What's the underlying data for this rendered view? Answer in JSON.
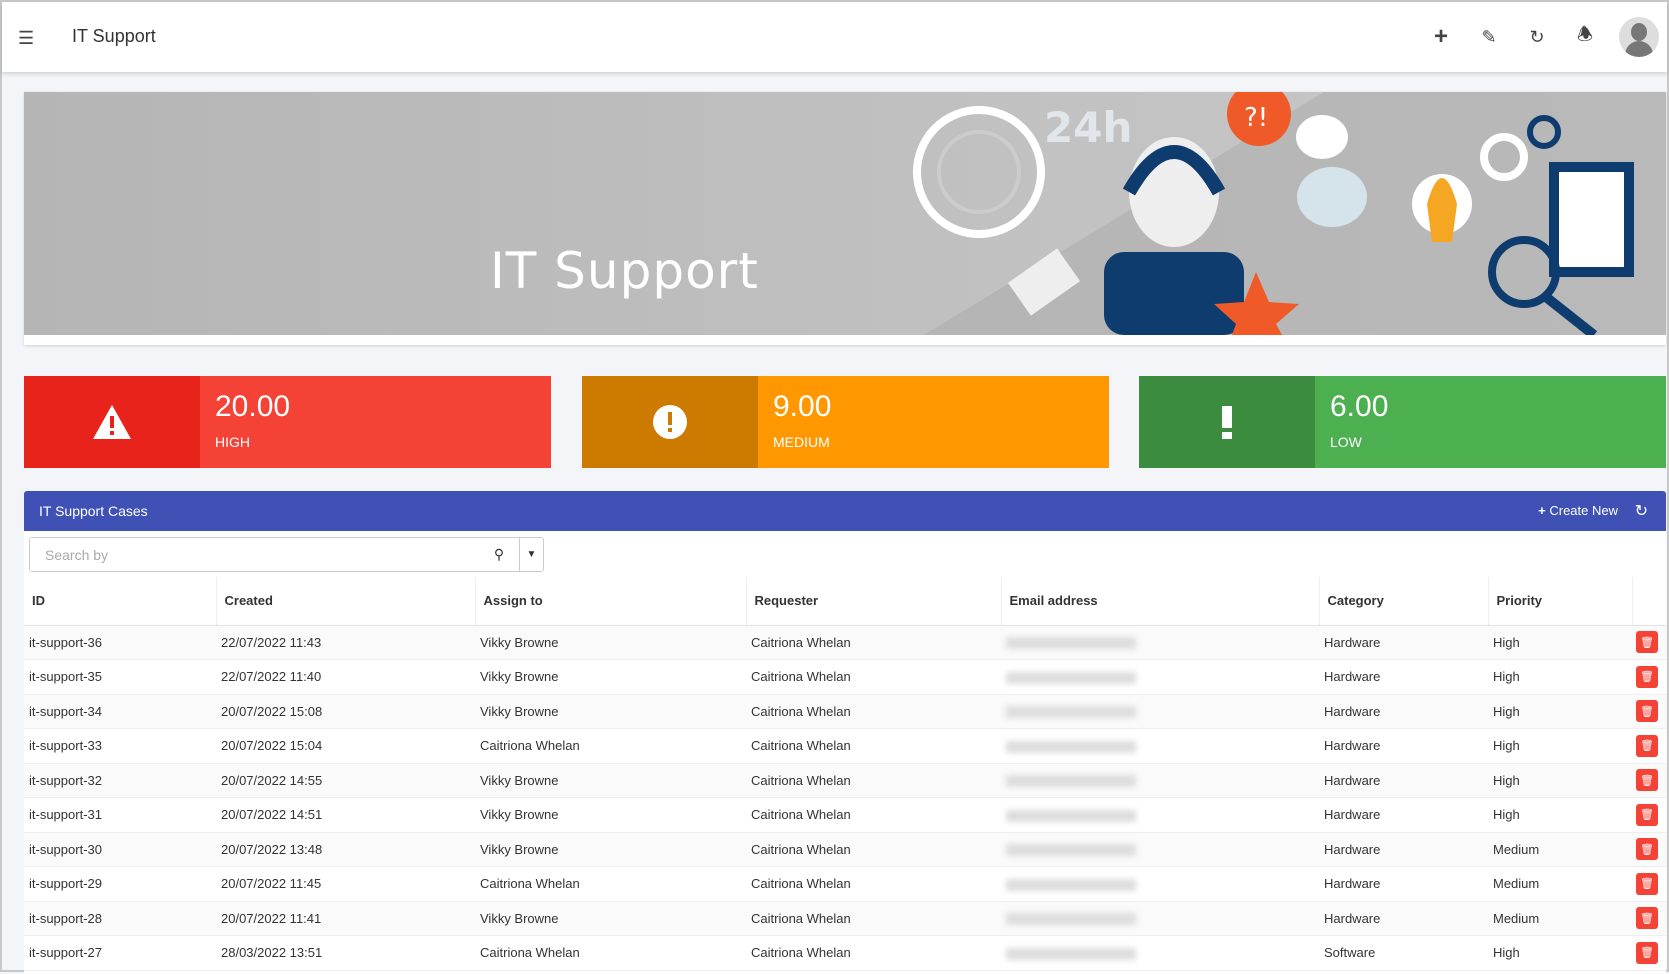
{
  "header": {
    "title": "IT Support",
    "icons": [
      "menu-icon",
      "plus-icon",
      "edit-icon",
      "refresh-icon",
      "bell-icon",
      "avatar"
    ]
  },
  "banner": {
    "title": "IT Support",
    "badge": "24h",
    "bubble": "?!"
  },
  "stats": [
    {
      "value": "20.00",
      "label": "HIGH",
      "color": "#f44336",
      "icon_bg": "#e8231b",
      "icon": "warning-triangle-icon"
    },
    {
      "value": "9.00",
      "label": "MEDIUM",
      "color": "#ff9800",
      "icon_bg": "#cc7a00",
      "icon": "exclamation-circle-icon"
    },
    {
      "value": "6.00",
      "label": "LOW",
      "color": "#4caf50",
      "icon_bg": "#3b8c3f",
      "icon": "exclamation-icon"
    }
  ],
  "panel": {
    "title": "IT Support Cases",
    "create_label": "Create New",
    "search_placeholder": "Search by"
  },
  "table": {
    "columns": [
      "ID",
      "Created",
      "Assign to",
      "Requester",
      "Email address",
      "Category",
      "Priority"
    ],
    "rows": [
      {
        "id": "it-support-36",
        "created": "22/07/2022 11:43",
        "assign": "Vikky Browne",
        "requester": "Caitriona Whelan",
        "category": "Hardware",
        "priority": "High"
      },
      {
        "id": "it-support-35",
        "created": "22/07/2022 11:40",
        "assign": "Vikky Browne",
        "requester": "Caitriona Whelan",
        "category": "Hardware",
        "priority": "High"
      },
      {
        "id": "it-support-34",
        "created": "20/07/2022 15:08",
        "assign": "Vikky Browne",
        "requester": "Caitriona Whelan",
        "category": "Hardware",
        "priority": "High"
      },
      {
        "id": "it-support-33",
        "created": "20/07/2022 15:04",
        "assign": "Caitriona Whelan",
        "requester": "Caitriona Whelan",
        "category": "Hardware",
        "priority": "High"
      },
      {
        "id": "it-support-32",
        "created": "20/07/2022 14:55",
        "assign": "Vikky Browne",
        "requester": "Caitriona Whelan",
        "category": "Hardware",
        "priority": "High"
      },
      {
        "id": "it-support-31",
        "created": "20/07/2022 14:51",
        "assign": "Vikky Browne",
        "requester": "Caitriona Whelan",
        "category": "Hardware",
        "priority": "High"
      },
      {
        "id": "it-support-30",
        "created": "20/07/2022 13:48",
        "assign": "Vikky Browne",
        "requester": "Caitriona Whelan",
        "category": "Hardware",
        "priority": "Medium"
      },
      {
        "id": "it-support-29",
        "created": "20/07/2022 11:45",
        "assign": "Caitriona Whelan",
        "requester": "Caitriona Whelan",
        "category": "Hardware",
        "priority": "Medium"
      },
      {
        "id": "it-support-28",
        "created": "20/07/2022 11:41",
        "assign": "Vikky Browne",
        "requester": "Caitriona Whelan",
        "category": "Hardware",
        "priority": "Medium"
      },
      {
        "id": "it-support-27",
        "created": "28/03/2022 13:51",
        "assign": "Caitriona Whelan",
        "requester": "Caitriona Whelan",
        "category": "Software",
        "priority": "High"
      }
    ]
  }
}
